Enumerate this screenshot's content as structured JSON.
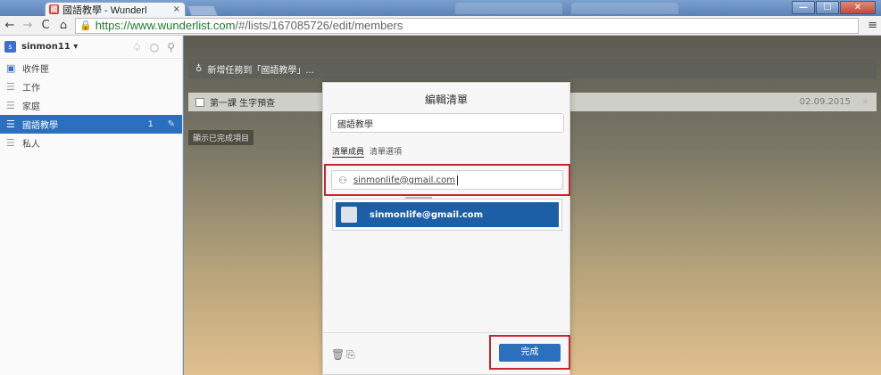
{
  "browser": {
    "tab_title": "國語教學 - Wunderl",
    "tab_favicon": "國",
    "close_glyph": "×",
    "url_scheme": "https://",
    "url_host": "www.wunderlist.com",
    "url_path": "/#/lists/167085726/edit/members",
    "window_buttons": [
      "—",
      "☐",
      "✕"
    ]
  },
  "sidebar": {
    "user_initial": "s",
    "username": "sinmon11 ▾",
    "items": [
      {
        "label": "收件匣",
        "icon": "inbox-icon"
      },
      {
        "label": "工作",
        "icon": "list-icon"
      },
      {
        "label": "家庭",
        "icon": "list-icon"
      },
      {
        "label": "國語教學",
        "icon": "list-icon",
        "count": "1",
        "active": true
      },
      {
        "label": "私人",
        "icon": "list-icon"
      }
    ]
  },
  "main": {
    "add_placeholder": "新增任務到「國語教學」...",
    "task": {
      "label": "第一課 生字預查",
      "due": "02.09.2015"
    },
    "show_completed": "顯示已完成項目"
  },
  "modal": {
    "title": "編輯清單",
    "list_name": "國語教學",
    "tabs": [
      "清單成員",
      "清單選項"
    ],
    "email_value": "sinmonlife@gmail.com",
    "suggestion": "sinmonlife@gmail.com",
    "done_label": "完成"
  },
  "colors": {
    "accent": "#2b6fbe",
    "highlight_red": "#c8262b"
  }
}
